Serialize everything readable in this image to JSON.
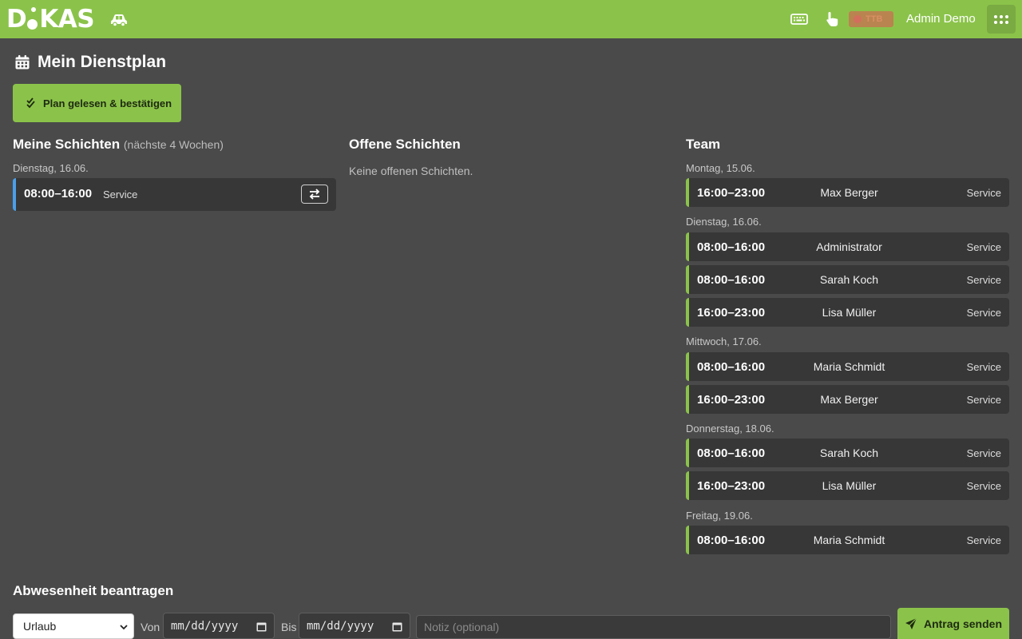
{
  "topbar": {
    "logo": {
      "pre": "D",
      "post": "KAS"
    },
    "user_name": "Admin Demo",
    "ttb_badge": "TTB"
  },
  "page": {
    "title": "Mein Dienstplan",
    "confirm_label": "Plan gelesen & bestätigen"
  },
  "my_shifts": {
    "title": "Meine Schichten",
    "subtitle": "(nächste 4 Wochen)",
    "day": "Dienstag, 16.06.",
    "shift": {
      "time": "08:00–16:00",
      "role": "Service"
    }
  },
  "open_shifts": {
    "title": "Offene Schichten",
    "empty": "Keine offenen Schichten."
  },
  "team": {
    "title": "Team",
    "days": [
      {
        "label": "Montag, 15.06.",
        "shifts": [
          {
            "time": "16:00–23:00",
            "person": "Max Berger",
            "role": "Service"
          }
        ]
      },
      {
        "label": "Dienstag, 16.06.",
        "shifts": [
          {
            "time": "08:00–16:00",
            "person": "Administrator",
            "role": "Service"
          },
          {
            "time": "08:00–16:00",
            "person": "Sarah Koch",
            "role": "Service"
          },
          {
            "time": "16:00–23:00",
            "person": "Lisa Müller",
            "role": "Service"
          }
        ]
      },
      {
        "label": "Mittwoch, 17.06.",
        "shifts": [
          {
            "time": "08:00–16:00",
            "person": "Maria Schmidt",
            "role": "Service"
          },
          {
            "time": "16:00–23:00",
            "person": "Max Berger",
            "role": "Service"
          }
        ]
      },
      {
        "label": "Donnerstag, 18.06.",
        "shifts": [
          {
            "time": "08:00–16:00",
            "person": "Sarah Koch",
            "role": "Service"
          },
          {
            "time": "16:00–23:00",
            "person": "Lisa Müller",
            "role": "Service"
          }
        ]
      },
      {
        "label": "Freitag, 19.06.",
        "shifts": [
          {
            "time": "08:00–16:00",
            "person": "Maria Schmidt",
            "role": "Service"
          }
        ]
      }
    ]
  },
  "absence": {
    "title": "Abwesenheit beantragen",
    "type_value": "Urlaub",
    "from_label": "Von",
    "to_label": "Bis",
    "date_placeholder": "mm/dd/yyyy",
    "note_placeholder": "Notiz (optional)",
    "send_label": "Antrag senden"
  },
  "colors": {
    "accent": "#8bc34a",
    "background": "#4a4a4a",
    "card": "#373737",
    "my_shift_marker": "#4a9fe8"
  },
  "icons": {
    "topbar": [
      "car-icon",
      "keyboard-icon",
      "hand-pointer-icon",
      "record-icon",
      "apps-grid-icon"
    ],
    "page": [
      "calendar-icon",
      "double-check-icon",
      "swap-icon",
      "send-icon",
      "chevron-down-icon"
    ]
  }
}
